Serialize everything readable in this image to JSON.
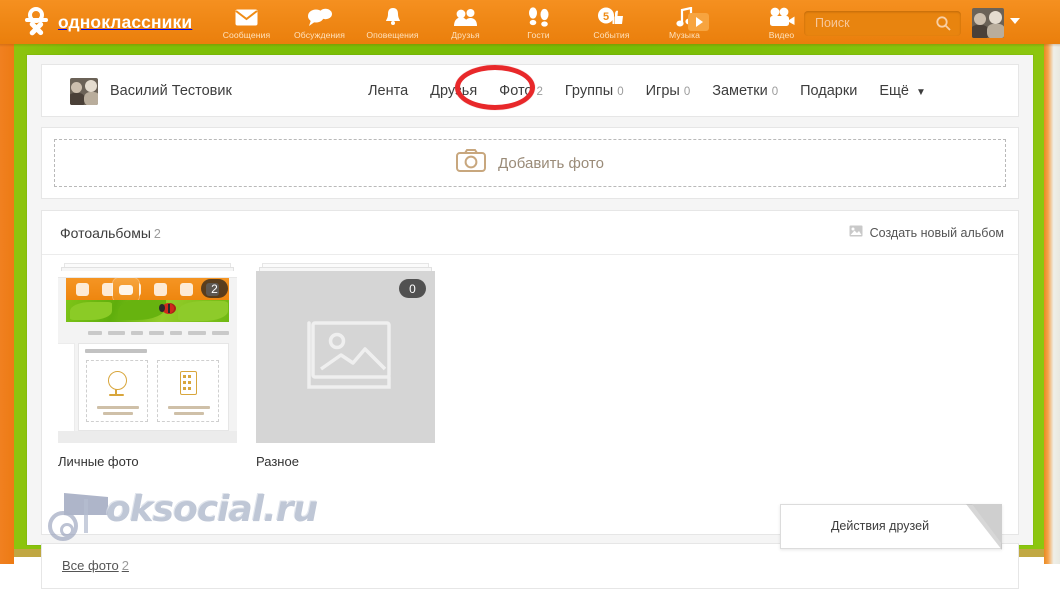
{
  "site": {
    "brand": "одноклассники",
    "brand_icon": "ok-logo-icon"
  },
  "navbar": {
    "items": [
      {
        "label": "Сообщения",
        "icon": "envelope-icon"
      },
      {
        "label": "Обсуждения",
        "icon": "speech-bubbles-icon"
      },
      {
        "label": "Оповещения",
        "icon": "bell-icon"
      },
      {
        "label": "Друзья",
        "icon": "people-icon"
      },
      {
        "label": "Гости",
        "icon": "footprints-icon"
      },
      {
        "label": "События",
        "icon": "calendar-hand-icon",
        "badge": "5"
      },
      {
        "label": "Музыка",
        "icon": "music-note-icon"
      },
      {
        "label": "Видео",
        "icon": "video-camera-icon"
      }
    ],
    "search": {
      "placeholder": "Поиск",
      "icon": "search-icon"
    },
    "avatar": {
      "icon": "user-avatar",
      "caret": "chevron-down-icon"
    }
  },
  "profile": {
    "name": "Василий Тестовик",
    "avatar_icon": "user-avatar"
  },
  "tabs": [
    {
      "label": "Лента",
      "count": "",
      "active": false
    },
    {
      "label": "Друзья",
      "count": "",
      "active": false
    },
    {
      "label": "Фото",
      "count": "2",
      "active": true
    },
    {
      "label": "Группы",
      "count": "0",
      "active": false
    },
    {
      "label": "Игры",
      "count": "0",
      "active": false
    },
    {
      "label": "Заметки",
      "count": "0",
      "active": false
    },
    {
      "label": "Подарки",
      "count": "",
      "active": false
    },
    {
      "label": "Ещё",
      "count": "",
      "active": false,
      "caret": "▼"
    }
  ],
  "add_photo": {
    "label": "Добавить фото",
    "icon": "camera-icon"
  },
  "albums_section": {
    "title": "Фотоальбомы",
    "count": "2",
    "create_label": "Создать новый альбом",
    "create_icon": "image-icon",
    "albums": [
      {
        "name": "Личные фото",
        "badge": "2",
        "thumb": "profile-page-screenshot"
      },
      {
        "name": "Разное",
        "badge": "0",
        "thumb": "empty-album-placeholder",
        "placeholder_icon": "photo-album-icon"
      }
    ]
  },
  "all_photos": {
    "label": "Все фото",
    "count": "2"
  },
  "watermark": {
    "text": "oksocial.ru",
    "icon": "film-camera-icon"
  },
  "friends_popup": {
    "label": "Действия друзей"
  },
  "annotation": {
    "type": "red-ellipse-highlight",
    "target": "Фото 2",
    "color": "#e8282a"
  },
  "colors": {
    "brand_orange": "#f08816",
    "page_green": "#7fc008",
    "accent_red": "#e8282a",
    "text_dark": "#3d3d3d",
    "text_muted": "#9b9b9b"
  }
}
